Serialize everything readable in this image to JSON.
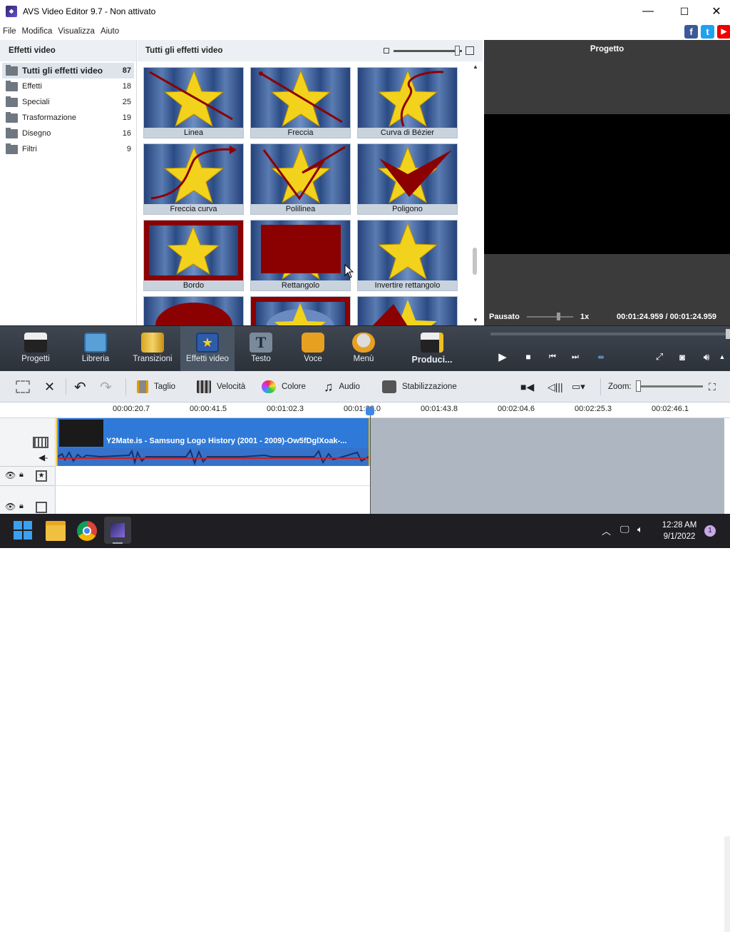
{
  "window": {
    "title": "AVS Video Editor 9.7 - Non attivato",
    "minimize": "—",
    "maximize": "☐",
    "close": "✕"
  },
  "menu": [
    "File",
    "Modifica",
    "Visualizza",
    "Aiuto"
  ],
  "social": [
    "f",
    "t",
    "▶"
  ],
  "categories_panel": {
    "title": "Effetti video",
    "items": [
      {
        "label": "Tutti gli effetti video",
        "count": "87"
      },
      {
        "label": "Effetti",
        "count": "18"
      },
      {
        "label": "Speciali",
        "count": "25"
      },
      {
        "label": "Trasformazione",
        "count": "19"
      },
      {
        "label": "Disegno",
        "count": "16"
      },
      {
        "label": "Filtri",
        "count": "9"
      }
    ]
  },
  "effects_panel": {
    "title": "Tutti gli effetti video",
    "tiles": [
      "Linea",
      "Freccia",
      "Curva di Bézier",
      "Freccia curva",
      "Polilinea",
      "Poligono",
      "Bordo",
      "Rettangolo",
      "Invertire rettangolo"
    ]
  },
  "preview": {
    "title": "Progetto",
    "status": "Pausato",
    "speed": "1x",
    "time": "00:01:24.959  /  00:01:24.959"
  },
  "main_toolbar": [
    "Progetti",
    "Libreria",
    "Transizioni",
    "Effetti video",
    "Testo",
    "Voce",
    "Menù",
    "Produci..."
  ],
  "timeline_toolbar": {
    "cut": "Taglio",
    "speed": "Velocità",
    "color": "Colore",
    "audio": "Audio",
    "stabilization": "Stabilizzazione",
    "zoom": "Zoom:"
  },
  "ruler_ticks": [
    "00:00:20.7",
    "00:00:41.5",
    "00:01:02.3",
    "00:01:23.0",
    "00:01:43.8",
    "00:02:04.6",
    "00:02:25.3",
    "00:02:46.1"
  ],
  "clip": {
    "title": "Y2Mate.is - Samsung Logo History (2001 - 2009)-Ow5fDglXoak-..."
  },
  "taskbar": {
    "time": "12:28 AM",
    "date": "9/1/2022",
    "badge": "1"
  },
  "colors": {
    "accent": "#2f7ad8",
    "toolbar_dark": "#353b43",
    "frame_red": "#8b0000",
    "star": "#f2d21c"
  }
}
